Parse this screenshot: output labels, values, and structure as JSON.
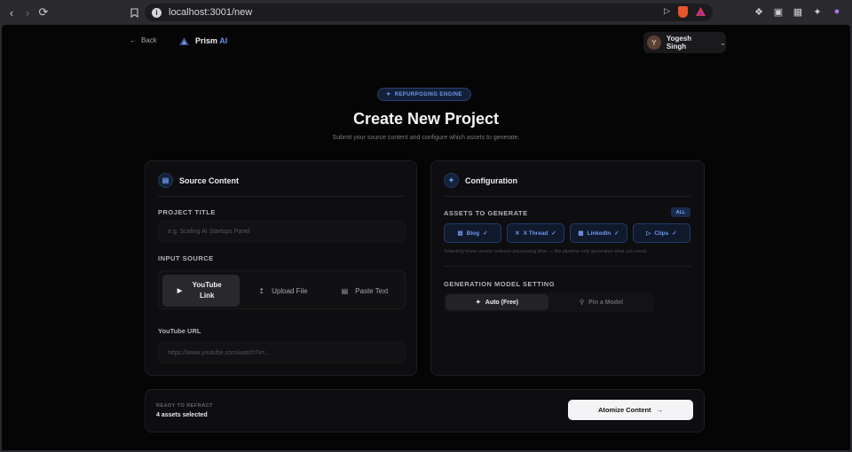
{
  "browser": {
    "url": "localhost:3001/new"
  },
  "nav": {
    "back_label": "Back",
    "brand_name": "Prism",
    "brand_suffix": "AI",
    "user_initial": "Y",
    "user_name": "Yogesh Singh"
  },
  "hero": {
    "badge": "REPURPOSING ENGINE",
    "title": "Create New Project",
    "subtitle": "Submit your source content and configure which assets to generate."
  },
  "source": {
    "heading": "Source Content",
    "project_title_label": "PROJECT TITLE",
    "project_title_placeholder": "e.g. Scaling AI Startups Panel",
    "input_source_label": "INPUT SOURCE",
    "options": [
      {
        "label": "YouTube Link",
        "icon": "youtube-icon",
        "active": true
      },
      {
        "label": "Upload File",
        "icon": "upload-icon",
        "active": false
      },
      {
        "label": "Paste Text",
        "icon": "document-icon",
        "active": false
      }
    ],
    "url_label": "YouTube URL",
    "url_placeholder": "https://www.youtube.com/watch?v=..."
  },
  "config": {
    "heading": "Configuration",
    "assets_label": "ASSETS TO GENERATE",
    "all_badge": "ALL",
    "assets": [
      {
        "label": "Blog",
        "icon": "blog-icon",
        "selected": true
      },
      {
        "label": "X Thread",
        "icon": "x-icon",
        "selected": true
      },
      {
        "label": "LinkedIn",
        "icon": "linkedin-icon",
        "selected": true
      },
      {
        "label": "Clips",
        "icon": "video-icon",
        "selected": true
      }
    ],
    "hint": "Selecting fewer assets reduces processing time — the pipeline only generates what you need.",
    "model_label": "GENERATION MODEL SETTING",
    "model_auto": "Auto (Free)",
    "model_pin": "Pin a Model"
  },
  "footer": {
    "status": "READY TO REFRACT",
    "count": "4 assets selected",
    "cta": "Atomize Content"
  },
  "colors": {
    "accent": "#6f98ee",
    "page_bg": "#050506",
    "card_bg": "#0e0e10"
  }
}
